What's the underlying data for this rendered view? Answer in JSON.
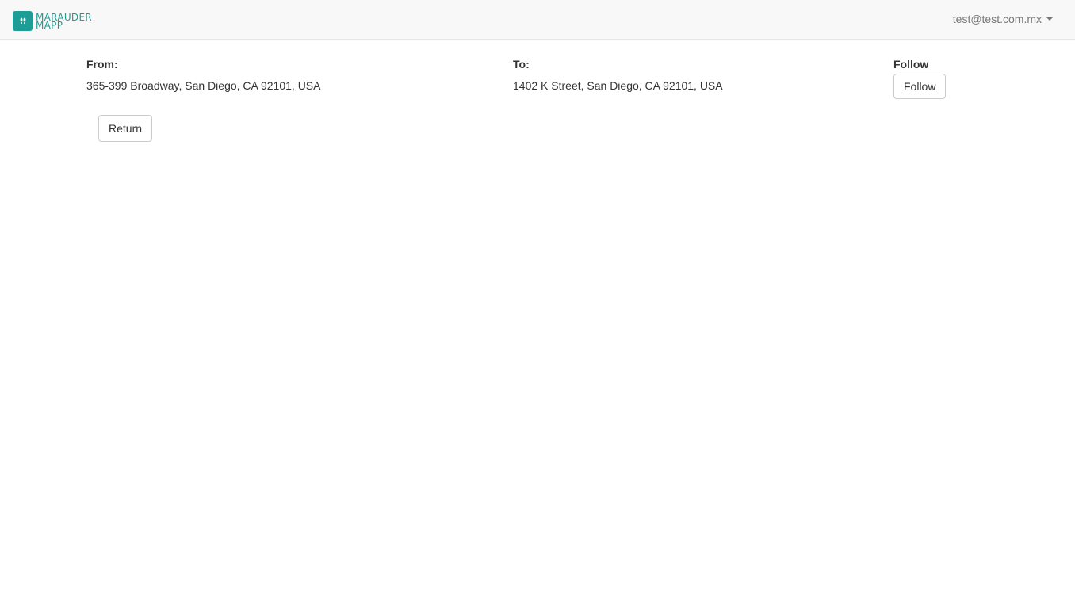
{
  "brand": {
    "line1": "MARAUDER",
    "line2": "MAPP",
    "accent_color": "#1c9e96",
    "icon": "footprints-icon"
  },
  "user_menu": {
    "email": "test@test.com.mx",
    "icon": "caret-down-icon"
  },
  "from": {
    "label": "From:",
    "address": "365-399 Broadway, San Diego, CA 92101, USA"
  },
  "to": {
    "label": "To:",
    "address": "1402 K Street, San Diego, CA 92101, USA"
  },
  "follow": {
    "label": "Follow",
    "button_label": "Follow"
  },
  "return_button": {
    "label": "Return"
  }
}
